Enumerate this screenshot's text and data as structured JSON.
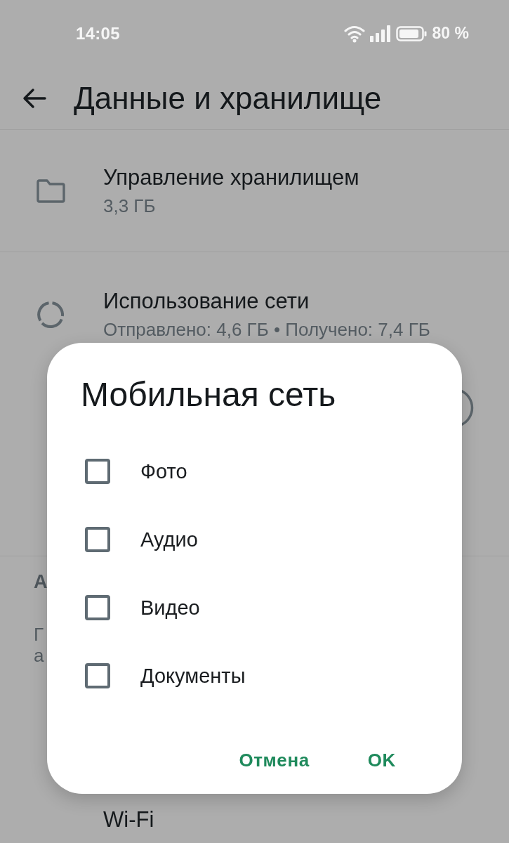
{
  "status_bar": {
    "time": "14:05",
    "battery": "80 %"
  },
  "app_bar": {
    "title": "Данные и хранилище"
  },
  "settings": [
    {
      "kind": "folder",
      "title": "Управление хранилищем",
      "subtitle": "3,3 ГБ"
    },
    {
      "kind": "data-usage",
      "title": "Использование сети",
      "subtitle": "Отправлено: 4,6 ГБ • Получено: 7,4 ГБ"
    }
  ],
  "section": {
    "header": "А",
    "description_lines": [
      "Г",
      "а"
    ]
  },
  "wifi_row": {
    "title": "Wi-Fi"
  },
  "dialog": {
    "title": "Мобильная сеть",
    "options": [
      {
        "label": "Фото",
        "checked": false
      },
      {
        "label": "Аудио",
        "checked": false
      },
      {
        "label": "Видео",
        "checked": false
      },
      {
        "label": "Документы",
        "checked": false
      }
    ],
    "buttons": [
      {
        "label": "Отмена"
      },
      {
        "label": "OK"
      }
    ]
  }
}
